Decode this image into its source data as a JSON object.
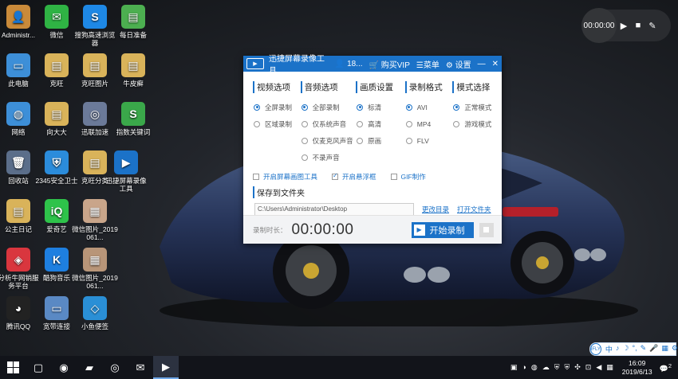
{
  "desktop_icons": [
    {
      "label": "Administr...",
      "glyph": "👤",
      "color": "#c98a3a"
    },
    {
      "label": "微信",
      "glyph": "✉",
      "color": "#2fb344"
    },
    {
      "label": "搜狗高速浏览器",
      "glyph": "S",
      "color": "#1e88e5"
    },
    {
      "label": "每日准备",
      "glyph": "▤",
      "color": "#4caf50"
    },
    {
      "label": "此电脑",
      "glyph": "▭",
      "color": "#3d8fd8"
    },
    {
      "label": "克旺",
      "glyph": "▤",
      "color": "#d9b35a"
    },
    {
      "label": "克旺图片",
      "glyph": "▤",
      "color": "#d9b35a"
    },
    {
      "label": "牛皮癣",
      "glyph": "▤",
      "color": "#d9b35a"
    },
    {
      "label": "网络",
      "glyph": "◍",
      "color": "#3d8fd8"
    },
    {
      "label": "向大大",
      "glyph": "▤",
      "color": "#d9b35a"
    },
    {
      "label": "迅联加速",
      "glyph": "◎",
      "color": "#6b7a99"
    },
    {
      "label": "指数关键词",
      "glyph": "S",
      "color": "#3aa84a"
    },
    {
      "label": "回收站",
      "glyph": "🗑",
      "color": "#5b6e8a"
    },
    {
      "label": "2345安全卫士",
      "glyph": "⛨",
      "color": "#2b8cdb"
    },
    {
      "label": "克旺分类",
      "glyph": "▤",
      "color": "#d9b35a"
    },
    {
      "label": "迅捷屏幕录像工具",
      "glyph": "▶",
      "color": "#1b72c8"
    },
    {
      "label": "公主日记",
      "glyph": "▤",
      "color": "#d9b35a"
    },
    {
      "label": "爱奇艺",
      "glyph": "iQ",
      "color": "#2ec34a"
    },
    {
      "label": "微信图片_2019061...",
      "glyph": "▦",
      "color": "#c9a58a"
    },
    {
      "label": "分析牛网销服务平台",
      "glyph": "◈",
      "color": "#d9363e"
    },
    {
      "label": "酷狗音乐",
      "glyph": "K",
      "color": "#1e7fe0"
    },
    {
      "label": "微信图片_2019061...",
      "glyph": "▦",
      "color": "#b89578"
    },
    {
      "label": "腾讯QQ",
      "glyph": "◕",
      "color": "#222222"
    },
    {
      "label": "宽带连接",
      "glyph": "▭",
      "color": "#5a89c4"
    },
    {
      "label": "小鱼便签",
      "glyph": "◇",
      "color": "#2a8fd6"
    }
  ],
  "rec_widget": {
    "time": "00:00:00",
    "play": "▶",
    "stop": "■",
    "edit": "✎"
  },
  "window": {
    "title": "迅捷屏幕录像工具",
    "user": "18...",
    "buy_vip": "购买VIP",
    "menu": "菜单",
    "settings": "设置",
    "minimize": "—",
    "close": "✕",
    "columns": [
      {
        "header": "视频选项",
        "options": [
          {
            "label": "全屏录制",
            "on": true
          },
          {
            "label": "区域录制",
            "on": false
          }
        ]
      },
      {
        "header": "音频选项",
        "options": [
          {
            "label": "全部录制",
            "on": true
          },
          {
            "label": "仅系统声音",
            "on": false
          },
          {
            "label": "仅麦克风声音",
            "on": false
          },
          {
            "label": "不录声音",
            "on": false
          }
        ]
      },
      {
        "header": "画质设置",
        "options": [
          {
            "label": "标清",
            "on": true
          },
          {
            "label": "高清",
            "on": false
          },
          {
            "label": "原画",
            "on": false
          }
        ]
      },
      {
        "header": "录制格式",
        "options": [
          {
            "label": "AVI",
            "on": true
          },
          {
            "label": "MP4",
            "on": false
          },
          {
            "label": "FLV",
            "on": false
          }
        ]
      },
      {
        "header": "模式选择",
        "options": [
          {
            "label": "正常模式",
            "on": true
          },
          {
            "label": "游戏模式",
            "on": false
          }
        ]
      }
    ],
    "checks": [
      {
        "label": "开启屏幕画图工具",
        "on": false
      },
      {
        "label": "开启悬浮框",
        "on": true
      },
      {
        "label": "GIF制作",
        "on": false
      }
    ],
    "save_header": "保存到文件夹",
    "save_path": "C:\\Users\\Administrator\\Desktop",
    "change_dir": "更改目录",
    "open_dir": "打开文件夹",
    "duration_label": "录制时长：",
    "duration": "00:00:00",
    "start_label": "开始录制"
  },
  "ime": {
    "brand": "iFLY",
    "items": [
      "中",
      "♪",
      "☽",
      "°,",
      "✎",
      "🎤",
      "▦",
      "⚙"
    ]
  },
  "taskbar": {
    "apps": [
      "▢",
      "◉",
      "▰",
      "◎",
      "✉",
      "▶"
    ],
    "tray_icons": [
      "▣",
      "◑",
      "◍",
      "☁",
      "⛨",
      "⛨",
      "✣",
      "⊡",
      "◀",
      "▦"
    ],
    "time": "16:09",
    "date": "2019/6/13",
    "notification": "2"
  }
}
